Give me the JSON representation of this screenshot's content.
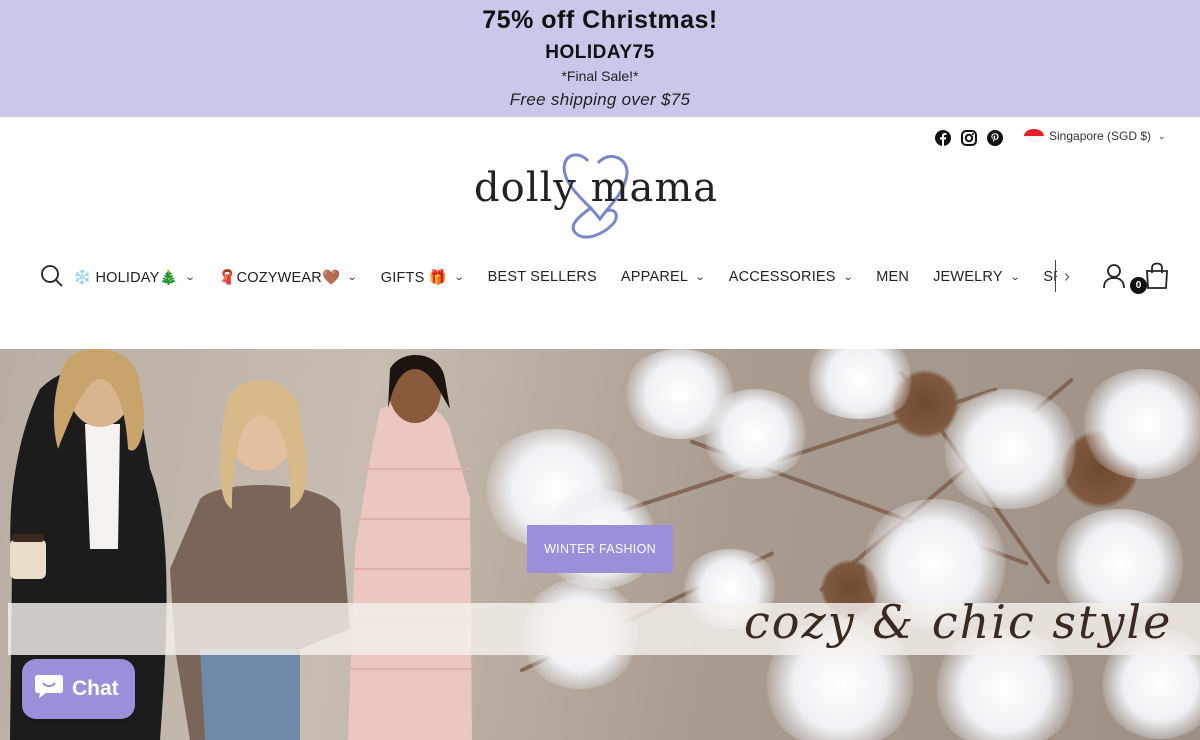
{
  "announcement": {
    "headline": "75% off Christmas!",
    "code": "HOLIDAY75",
    "note": "*Final Sale!*",
    "shipping": "Free shipping over $75",
    "background": "#c9c8eb"
  },
  "header": {
    "social": [
      {
        "icon": "facebook-icon"
      },
      {
        "icon": "instagram-icon"
      },
      {
        "icon": "pinterest-icon"
      }
    ],
    "locale": {
      "label": "Singapore (SGD $)",
      "flag": "singapore-flag-icon"
    },
    "logo": {
      "text": "dolly mama",
      "accent_color": "#7b86c9"
    }
  },
  "nav": {
    "items": [
      {
        "label": "❄️ HOLIDAY🎄",
        "has_dropdown": true
      },
      {
        "label": "🧣COZYWEAR🤎",
        "has_dropdown": true
      },
      {
        "label": "GIFTS 🎁",
        "has_dropdown": true
      },
      {
        "label": "BEST SELLERS",
        "has_dropdown": false
      },
      {
        "label": "APPAREL",
        "has_dropdown": true
      },
      {
        "label": "ACCESSORIES",
        "has_dropdown": true
      },
      {
        "label": "MEN",
        "has_dropdown": false
      },
      {
        "label": "JEWELRY",
        "has_dropdown": true
      },
      {
        "label": "SPA & BEAUTY",
        "has_dropdown": true
      }
    ],
    "cart_count": "0"
  },
  "hero": {
    "cta_label": "WINTER FASHION",
    "tagline": "cozy & chic style",
    "accent": "#9a8fd9"
  },
  "chat": {
    "label": "Chat"
  }
}
